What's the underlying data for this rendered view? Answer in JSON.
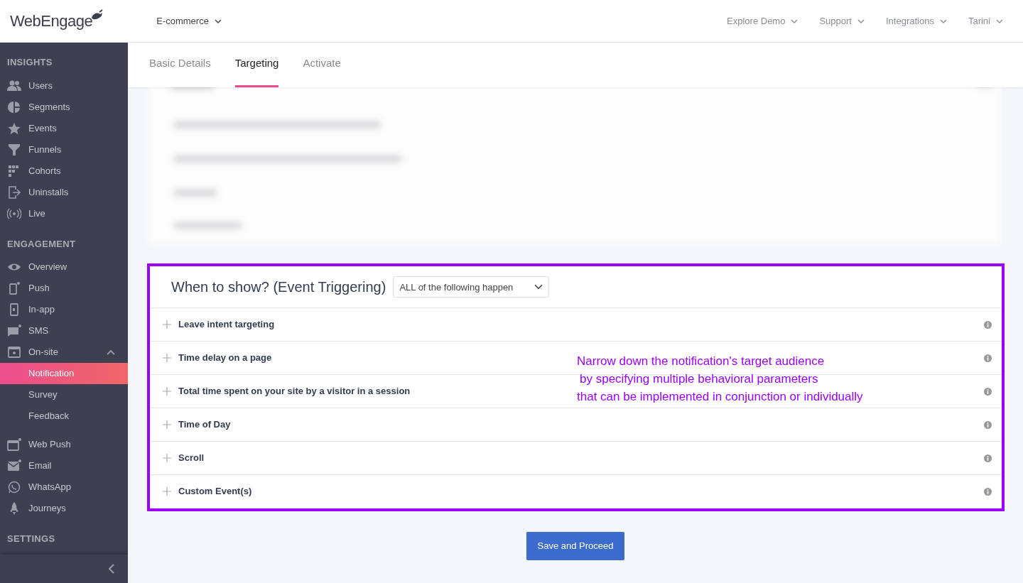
{
  "top_bar": {
    "logo": "WebEngage",
    "project": "E-commerce",
    "menu": [
      "Explore Demo",
      "Support",
      "Integrations",
      "Tarini"
    ]
  },
  "sidebar": {
    "sections": [
      {
        "title": "INSIGHTS",
        "items": [
          {
            "label": "Users",
            "selected": false
          },
          {
            "label": "Segments",
            "selected": false
          },
          {
            "label": "Events",
            "selected": false
          },
          {
            "label": "Funnels",
            "selected": false
          },
          {
            "label": "Cohorts",
            "selected": false
          },
          {
            "label": "Uninstalls",
            "selected": false
          },
          {
            "label": "Live",
            "selected": false
          }
        ]
      },
      {
        "title": "ENGAGEMENT",
        "items": [
          {
            "label": "Overview",
            "selected": false
          },
          {
            "label": "Push",
            "selected": false
          },
          {
            "label": "In-app",
            "selected": false
          },
          {
            "label": "SMS",
            "selected": false
          },
          {
            "label": "On-site",
            "selected": false,
            "expanded": true,
            "children": [
              {
                "label": "Notification",
                "selected": true
              },
              {
                "label": "Survey",
                "selected": false
              },
              {
                "label": "Feedback",
                "selected": false
              }
            ]
          },
          {
            "label": "Web Push",
            "selected": false
          },
          {
            "label": "Email",
            "selected": false
          },
          {
            "label": "WhatsApp",
            "selected": false
          },
          {
            "label": "Journeys",
            "selected": false
          }
        ]
      },
      {
        "title": "SETTINGS"
      }
    ]
  },
  "tabs": [
    {
      "label": "Basic Details",
      "selected": false
    },
    {
      "label": "Targeting",
      "selected": true
    },
    {
      "label": "Activate",
      "selected": false
    }
  ],
  "event_panel": {
    "title": "When to show? (Event Triggering)",
    "match_select": {
      "value": "ALL of the following happen"
    },
    "conditions": [
      {
        "label": "Leave intent targeting"
      },
      {
        "label": "Time delay on a page"
      },
      {
        "label": "Total time spent on your site by a visitor in a session"
      },
      {
        "label": "Time of Day"
      },
      {
        "label": "Scroll"
      },
      {
        "label": "Custom Event(s)"
      }
    ],
    "annotation": [
      "Narrow down the notification's target audience",
      "by specifying multiple behavioral parameters",
      "that can be implemented in conjunction or individually"
    ]
  },
  "save_button": "Save and Proceed"
}
